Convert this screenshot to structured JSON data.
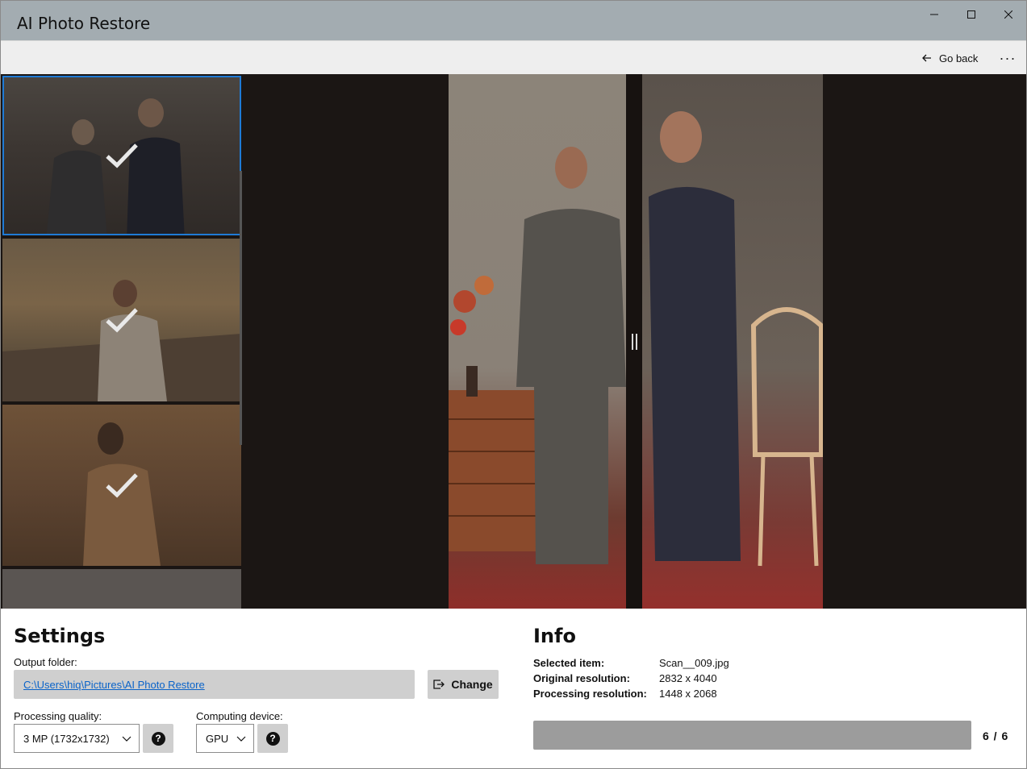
{
  "window": {
    "title": "AI Photo Restore",
    "controls": [
      "minimize-icon",
      "maximize-icon",
      "close-icon"
    ]
  },
  "command_bar": {
    "go_back_label": "Go back",
    "go_back_icon": "arrow-left-icon",
    "more_label": "···"
  },
  "thumbnails": {
    "items": [
      {
        "selected": true,
        "processed": true,
        "status_icon": "checkmark-icon"
      },
      {
        "selected": false,
        "processed": true,
        "status_icon": "checkmark-icon"
      },
      {
        "selected": false,
        "processed": true,
        "status_icon": "checkmark-icon"
      },
      {
        "selected": false,
        "processed": false
      }
    ]
  },
  "viewer": {
    "compare_handle_icon": "split-handle-icon"
  },
  "settings": {
    "heading": "Settings",
    "output_folder_label": "Output folder:",
    "output_folder_path": "C:\\Users\\hiq\\Pictures\\AI Photo Restore",
    "change_label": "Change",
    "change_icon": "open-folder-icon",
    "quality_label": "Processing quality:",
    "quality_value": "3 MP (1732x1732)",
    "device_label": "Computing device:",
    "device_value": "GPU",
    "help_label": "?"
  },
  "info": {
    "heading": "Info",
    "rows": [
      {
        "key": "Selected item:",
        "value": "Scan__009.jpg"
      },
      {
        "key": "Original resolution:",
        "value": "2832 x 4040"
      },
      {
        "key": "Processing resolution:",
        "value": "1448 x 2068"
      }
    ],
    "progress_fraction": 1.0,
    "counter": "6 / 6"
  },
  "colors": {
    "titlebar": "#a3acb1",
    "accent": "#1f7bd6",
    "link": "#0a63c9",
    "button_bg": "#cfcfcf",
    "progress": "#9c9c9c"
  }
}
